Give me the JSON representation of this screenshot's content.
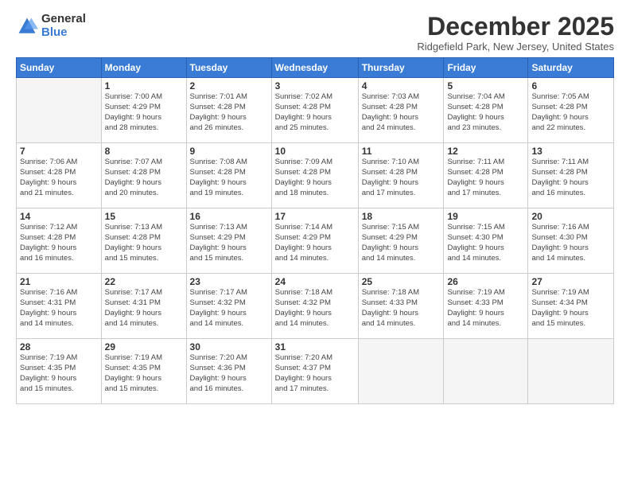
{
  "logo": {
    "general": "General",
    "blue": "Blue"
  },
  "title": {
    "month": "December 2025",
    "location": "Ridgefield Park, New Jersey, United States"
  },
  "headers": [
    "Sunday",
    "Monday",
    "Tuesday",
    "Wednesday",
    "Thursday",
    "Friday",
    "Saturday"
  ],
  "weeks": [
    [
      {
        "num": "",
        "info": ""
      },
      {
        "num": "1",
        "info": "Sunrise: 7:00 AM\nSunset: 4:29 PM\nDaylight: 9 hours\nand 28 minutes."
      },
      {
        "num": "2",
        "info": "Sunrise: 7:01 AM\nSunset: 4:28 PM\nDaylight: 9 hours\nand 26 minutes."
      },
      {
        "num": "3",
        "info": "Sunrise: 7:02 AM\nSunset: 4:28 PM\nDaylight: 9 hours\nand 25 minutes."
      },
      {
        "num": "4",
        "info": "Sunrise: 7:03 AM\nSunset: 4:28 PM\nDaylight: 9 hours\nand 24 minutes."
      },
      {
        "num": "5",
        "info": "Sunrise: 7:04 AM\nSunset: 4:28 PM\nDaylight: 9 hours\nand 23 minutes."
      },
      {
        "num": "6",
        "info": "Sunrise: 7:05 AM\nSunset: 4:28 PM\nDaylight: 9 hours\nand 22 minutes."
      }
    ],
    [
      {
        "num": "7",
        "info": "Sunrise: 7:06 AM\nSunset: 4:28 PM\nDaylight: 9 hours\nand 21 minutes."
      },
      {
        "num": "8",
        "info": "Sunrise: 7:07 AM\nSunset: 4:28 PM\nDaylight: 9 hours\nand 20 minutes."
      },
      {
        "num": "9",
        "info": "Sunrise: 7:08 AM\nSunset: 4:28 PM\nDaylight: 9 hours\nand 19 minutes."
      },
      {
        "num": "10",
        "info": "Sunrise: 7:09 AM\nSunset: 4:28 PM\nDaylight: 9 hours\nand 18 minutes."
      },
      {
        "num": "11",
        "info": "Sunrise: 7:10 AM\nSunset: 4:28 PM\nDaylight: 9 hours\nand 17 minutes."
      },
      {
        "num": "12",
        "info": "Sunrise: 7:11 AM\nSunset: 4:28 PM\nDaylight: 9 hours\nand 17 minutes."
      },
      {
        "num": "13",
        "info": "Sunrise: 7:11 AM\nSunset: 4:28 PM\nDaylight: 9 hours\nand 16 minutes."
      }
    ],
    [
      {
        "num": "14",
        "info": "Sunrise: 7:12 AM\nSunset: 4:28 PM\nDaylight: 9 hours\nand 16 minutes."
      },
      {
        "num": "15",
        "info": "Sunrise: 7:13 AM\nSunset: 4:28 PM\nDaylight: 9 hours\nand 15 minutes."
      },
      {
        "num": "16",
        "info": "Sunrise: 7:13 AM\nSunset: 4:29 PM\nDaylight: 9 hours\nand 15 minutes."
      },
      {
        "num": "17",
        "info": "Sunrise: 7:14 AM\nSunset: 4:29 PM\nDaylight: 9 hours\nand 14 minutes."
      },
      {
        "num": "18",
        "info": "Sunrise: 7:15 AM\nSunset: 4:29 PM\nDaylight: 9 hours\nand 14 minutes."
      },
      {
        "num": "19",
        "info": "Sunrise: 7:15 AM\nSunset: 4:30 PM\nDaylight: 9 hours\nand 14 minutes."
      },
      {
        "num": "20",
        "info": "Sunrise: 7:16 AM\nSunset: 4:30 PM\nDaylight: 9 hours\nand 14 minutes."
      }
    ],
    [
      {
        "num": "21",
        "info": "Sunrise: 7:16 AM\nSunset: 4:31 PM\nDaylight: 9 hours\nand 14 minutes."
      },
      {
        "num": "22",
        "info": "Sunrise: 7:17 AM\nSunset: 4:31 PM\nDaylight: 9 hours\nand 14 minutes."
      },
      {
        "num": "23",
        "info": "Sunrise: 7:17 AM\nSunset: 4:32 PM\nDaylight: 9 hours\nand 14 minutes."
      },
      {
        "num": "24",
        "info": "Sunrise: 7:18 AM\nSunset: 4:32 PM\nDaylight: 9 hours\nand 14 minutes."
      },
      {
        "num": "25",
        "info": "Sunrise: 7:18 AM\nSunset: 4:33 PM\nDaylight: 9 hours\nand 14 minutes."
      },
      {
        "num": "26",
        "info": "Sunrise: 7:19 AM\nSunset: 4:33 PM\nDaylight: 9 hours\nand 14 minutes."
      },
      {
        "num": "27",
        "info": "Sunrise: 7:19 AM\nSunset: 4:34 PM\nDaylight: 9 hours\nand 15 minutes."
      }
    ],
    [
      {
        "num": "28",
        "info": "Sunrise: 7:19 AM\nSunset: 4:35 PM\nDaylight: 9 hours\nand 15 minutes."
      },
      {
        "num": "29",
        "info": "Sunrise: 7:19 AM\nSunset: 4:35 PM\nDaylight: 9 hours\nand 15 minutes."
      },
      {
        "num": "30",
        "info": "Sunrise: 7:20 AM\nSunset: 4:36 PM\nDaylight: 9 hours\nand 16 minutes."
      },
      {
        "num": "31",
        "info": "Sunrise: 7:20 AM\nSunset: 4:37 PM\nDaylight: 9 hours\nand 17 minutes."
      },
      {
        "num": "",
        "info": ""
      },
      {
        "num": "",
        "info": ""
      },
      {
        "num": "",
        "info": ""
      }
    ]
  ]
}
